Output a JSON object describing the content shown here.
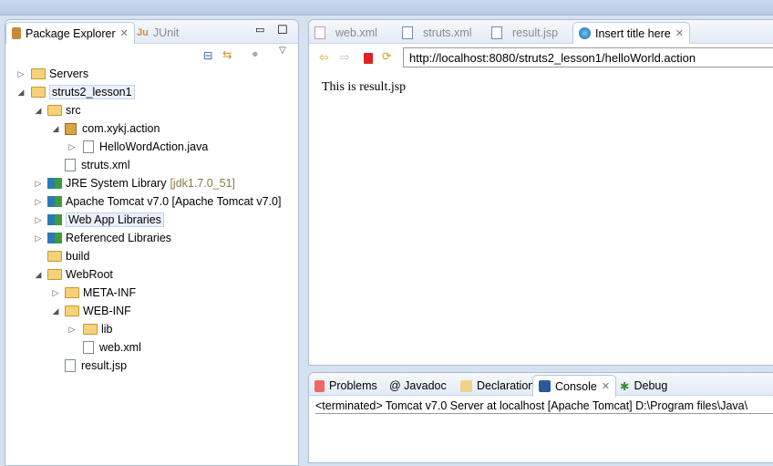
{
  "left_panel": {
    "tabs": [
      {
        "label": "Package Explorer",
        "active": true
      },
      {
        "label": "JUnit",
        "active": false
      }
    ]
  },
  "tree": [
    {
      "label": "Servers",
      "level": 0,
      "arrow": "collapsed",
      "icon": "folder-icon"
    },
    {
      "label": "struts2_lesson1",
      "level": 0,
      "arrow": "expanded",
      "icon": "project-icon",
      "selected": true
    },
    {
      "label": "src",
      "level": 1,
      "arrow": "expanded",
      "icon": "source-folder-icon"
    },
    {
      "label": "com.xykj.action",
      "level": 2,
      "arrow": "expanded",
      "icon": "package-icon"
    },
    {
      "label": "HelloWordAction.java",
      "level": 3,
      "arrow": "collapsed",
      "icon": "java-file-icon"
    },
    {
      "label": "struts.xml",
      "level": 2,
      "arrow": "none",
      "icon": "xml-file-icon"
    },
    {
      "label": "JRE System Library",
      "suffix": "[jdk1.7.0_51]",
      "level": 1,
      "arrow": "collapsed",
      "icon": "library-icon"
    },
    {
      "label": "Apache Tomcat v7.0 [Apache Tomcat v7.0]",
      "level": 1,
      "arrow": "collapsed",
      "icon": "library-icon"
    },
    {
      "label": "Web App Libraries",
      "level": 1,
      "arrow": "collapsed",
      "icon": "library-icon",
      "hover": true
    },
    {
      "label": "Referenced Libraries",
      "level": 1,
      "arrow": "collapsed",
      "icon": "library-icon"
    },
    {
      "label": "build",
      "level": 1,
      "arrow": "none",
      "icon": "folder-icon"
    },
    {
      "label": "WebRoot",
      "level": 1,
      "arrow": "expanded",
      "icon": "folder-icon"
    },
    {
      "label": "META-INF",
      "level": 2,
      "arrow": "collapsed",
      "icon": "folder-icon"
    },
    {
      "label": "WEB-INF",
      "level": 2,
      "arrow": "expanded",
      "icon": "folder-icon"
    },
    {
      "label": "lib",
      "level": 3,
      "arrow": "collapsed",
      "icon": "folder-icon"
    },
    {
      "label": "web.xml",
      "level": 3,
      "arrow": "none",
      "icon": "xml-file-icon"
    },
    {
      "label": "result.jsp",
      "level": 2,
      "arrow": "none",
      "icon": "jsp-file-icon"
    }
  ],
  "editor": {
    "tabs": [
      {
        "label": "web.xml"
      },
      {
        "label": "struts.xml"
      },
      {
        "label": "result.jsp"
      },
      {
        "label": "Insert title here",
        "active": true
      }
    ],
    "url": "http://localhost:8080/struts2_lesson1/helloWorld.action",
    "content": "This is result.jsp"
  },
  "bottom": {
    "tabs": [
      {
        "label": "Problems"
      },
      {
        "label": "@ Javadoc"
      },
      {
        "label": "Declaration"
      },
      {
        "label": "Console",
        "active": true
      },
      {
        "label": "Debug"
      }
    ],
    "console_header": "<terminated> Tomcat v7.0 Server at localhost [Apache Tomcat] D:\\Program files\\Java\\"
  }
}
